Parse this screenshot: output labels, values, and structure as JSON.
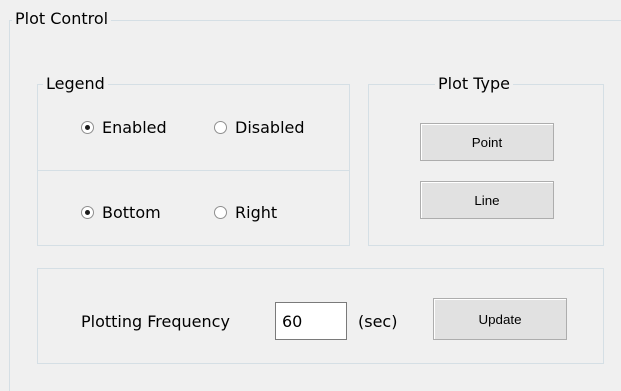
{
  "plot_control": {
    "title": "Plot Control",
    "legend": {
      "title": "Legend",
      "enabled_label": "Enabled",
      "disabled_label": "Disabled",
      "bottom_label": "Bottom",
      "right_label": "Right",
      "enabled_checked": true,
      "bottom_checked": true
    },
    "plot_type": {
      "title": "Plot Type",
      "point_label": "Point",
      "line_label": "Line"
    },
    "frequency": {
      "label": "Plotting Frequency",
      "value": "60",
      "unit": "(sec)",
      "update_label": "Update"
    }
  }
}
